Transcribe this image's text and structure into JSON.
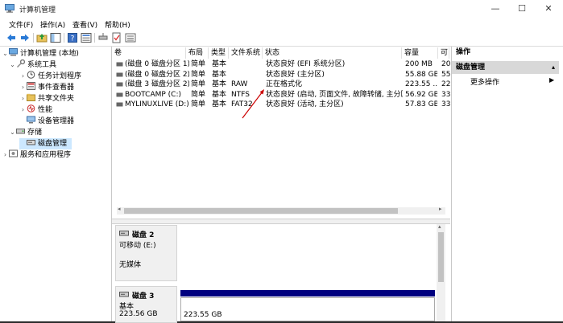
{
  "window": {
    "title": "计算机管理"
  },
  "menu": [
    "文件(F)",
    "操作(A)",
    "查看(V)",
    "帮助(H)"
  ],
  "tree": {
    "root": "计算机管理 (本地)",
    "system_tools": "系统工具",
    "task_scheduler": "任务计划程序",
    "event_viewer": "事件查看器",
    "shared_folders": "共享文件夹",
    "performance": "性能",
    "device_manager": "设备管理器",
    "storage": "存储",
    "disk_management": "磁盘管理",
    "services": "服务和应用程序"
  },
  "volume_table": {
    "columns": [
      "卷",
      "布局",
      "类型",
      "文件系统",
      "状态",
      "容量",
      "可"
    ],
    "rows": [
      {
        "vol": "(磁盘 0 磁盘分区 1)",
        "layout": "简单",
        "type": "基本",
        "fs": "",
        "status": "状态良好 (EFI 系统分区)",
        "cap": "200 MB",
        "free": "20"
      },
      {
        "vol": "(磁盘 0 磁盘分区 2)",
        "layout": "简单",
        "type": "基本",
        "fs": "",
        "status": "状态良好 (主分区)",
        "cap": "55.88 GB",
        "free": "55"
      },
      {
        "vol": "(磁盘 3 磁盘分区 2)",
        "layout": "简单",
        "type": "基本",
        "fs": "RAW",
        "status": "正在格式化",
        "cap": "223.55 ...",
        "free": "22"
      },
      {
        "vol": "BOOTCAMP (C:)",
        "layout": "简单",
        "type": "基本",
        "fs": "NTFS",
        "status": "状态良好 (启动, 页面文件, 故障转储, 主分区)",
        "cap": "56.92 GB",
        "free": "33"
      },
      {
        "vol": "MYLINUXLIVE (D:)",
        "layout": "简单",
        "type": "基本",
        "fs": "FAT32",
        "status": "状态良好 (活动, 主分区)",
        "cap": "57.83 GB",
        "free": "33"
      }
    ]
  },
  "disks": [
    {
      "name": "磁盘 2",
      "kind": "可移动 (E:)",
      "media": "无媒体"
    },
    {
      "name": "磁盘 3",
      "kind": "基本",
      "size": "223.56 GB",
      "partition_size": "223.55 GB"
    }
  ],
  "actions": {
    "header": "操作",
    "section": "磁盘管理",
    "more": "更多操作"
  },
  "colors": {
    "partition_bar": "#00007f",
    "selection": "#cce8ff",
    "arrow": "#cc0000"
  }
}
